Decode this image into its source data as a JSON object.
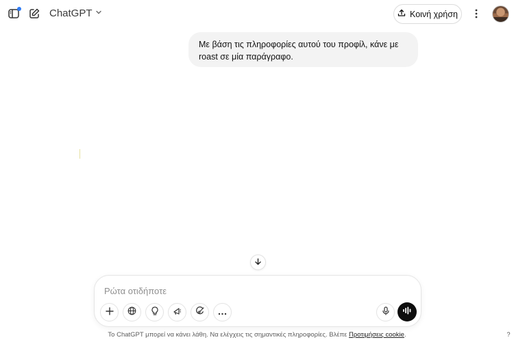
{
  "header": {
    "model_name": "ChatGPT",
    "share_label": "Κοινή χρήση",
    "icons": {
      "sidebar": "sidebar-toggle-icon",
      "new_chat": "new-chat-icon",
      "chevron": "chevron-down-icon",
      "share": "upload-icon",
      "more": "more-vertical-icon"
    },
    "notification_dot_color": "#2f7cf6"
  },
  "conversation": {
    "user_message": "Με βάση τις πληροφορίες αυτού του προφίλ, κάνε με roast σε μία παράγραφο."
  },
  "composer": {
    "placeholder": "Ρώτα οτιδήποτε",
    "value": "",
    "tools": [
      "plus-icon",
      "globe-icon",
      "lightbulb-icon",
      "megaphone-icon",
      "paint-icon",
      "ellipsis-icon"
    ],
    "voice_icon": "voice-waveform-icon",
    "mic_icon": "microphone-icon"
  },
  "footer": {
    "disclaimer": "Το ChatGPT μπορεί να κάνει λάθη. Να ελέγχεις τις σημαντικές πληροφορίες. Βλέπε",
    "link": "Προτιμήσεις cookie",
    "suffix": ".",
    "help": "?"
  }
}
